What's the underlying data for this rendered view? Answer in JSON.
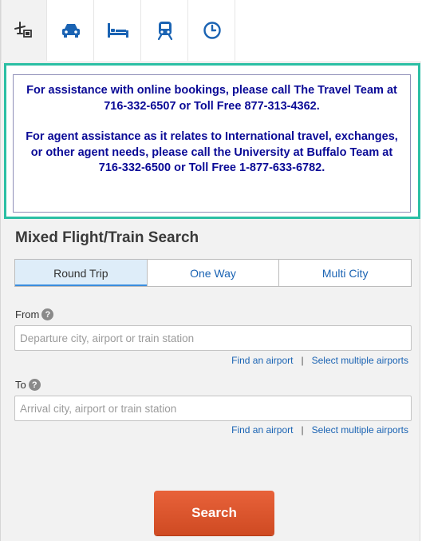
{
  "tabs": [
    {
      "name": "flight-hotel",
      "icon": "flight-hotel-icon",
      "active": true
    },
    {
      "name": "car",
      "icon": "car-icon",
      "active": false
    },
    {
      "name": "hotel",
      "icon": "bed-icon",
      "active": false
    },
    {
      "name": "train",
      "icon": "train-icon",
      "active": false
    },
    {
      "name": "recent",
      "icon": "clock-icon",
      "active": false
    }
  ],
  "notice": {
    "line1": "For assistance with online bookings, please call The Travel Team at 716-332-6507 or Toll Free 877-313-4362.",
    "line2": "For agent assistance as it relates to International travel, exchanges, or other agent needs, please call the University at Buffalo Team at 716-332-6500 or Toll Free 1-877-633-6782."
  },
  "search": {
    "heading": "Mixed Flight/Train Search",
    "trip_types": [
      "Round Trip",
      "One Way",
      "Multi City"
    ],
    "selected_trip_type": "Round Trip",
    "from_label": "From",
    "from_placeholder": "Departure city, airport or train station",
    "from_value": "",
    "to_label": "To",
    "to_placeholder": "Arrival city, airport or train station",
    "to_value": "",
    "help_symbol": "?",
    "find_airport": "Find an airport",
    "separator": "|",
    "select_multiple": "Select multiple airports",
    "submit": "Search"
  },
  "colors": {
    "accent_teal": "#2bbfa4",
    "notice_text": "#0a0a96",
    "link": "#1a63b3",
    "search_button": "#dc5530"
  }
}
